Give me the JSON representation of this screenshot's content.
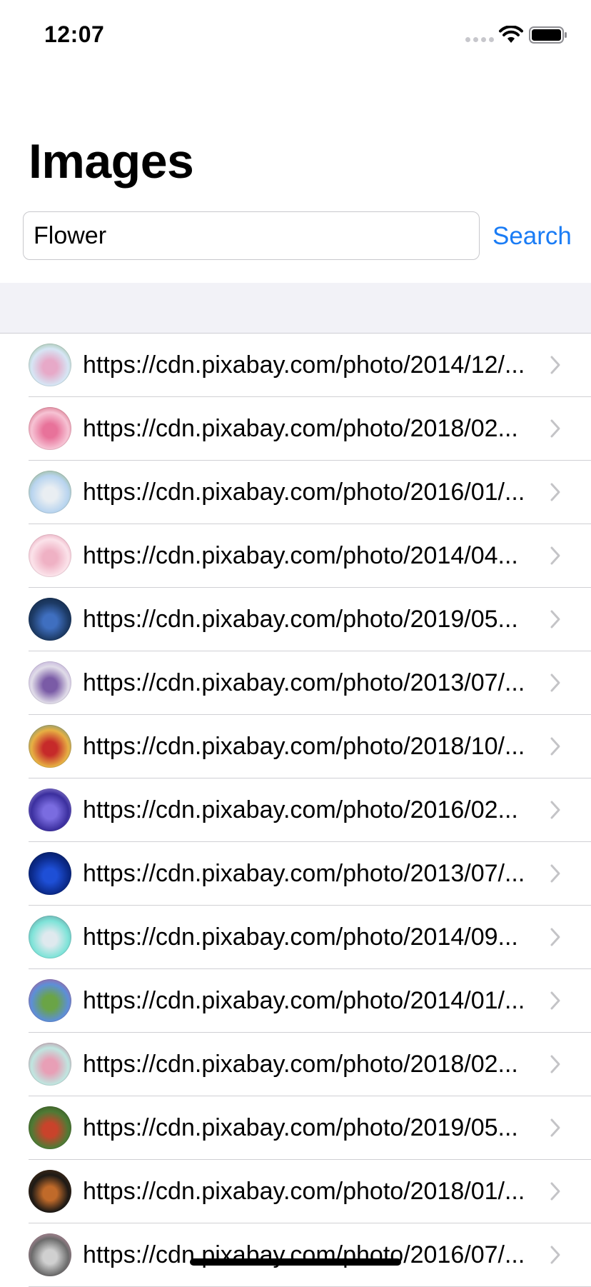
{
  "status_bar": {
    "time": "12:07"
  },
  "header": {
    "title": "Images"
  },
  "search": {
    "value": "Flower",
    "button_label": "Search"
  },
  "results": [
    {
      "url": "https://cdn.pixabay.com/photo/2014/12/...",
      "thumb_colors": [
        "#d6e6f5",
        "#e7a9c8",
        "#7aa86a"
      ]
    },
    {
      "url": "https://cdn.pixabay.com/photo/2018/02...",
      "thumb_colors": [
        "#f6c3d4",
        "#e8729a",
        "#c0364f"
      ]
    },
    {
      "url": "https://cdn.pixabay.com/photo/2016/01/...",
      "thumb_colors": [
        "#b8d4ef",
        "#e9eef2",
        "#8ba84e"
      ]
    },
    {
      "url": "https://cdn.pixabay.com/photo/2014/04...",
      "thumb_colors": [
        "#fbe3ea",
        "#efb1c4",
        "#d97a98"
      ]
    },
    {
      "url": "https://cdn.pixabay.com/photo/2019/05...",
      "thumb_colors": [
        "#1d3b66",
        "#3f6fc0",
        "#0f1f35"
      ]
    },
    {
      "url": "https://cdn.pixabay.com/photo/2013/07/...",
      "thumb_colors": [
        "#e0dce8",
        "#7a5ba6",
        "#a98bcf"
      ]
    },
    {
      "url": "https://cdn.pixabay.com/photo/2018/10/...",
      "thumb_colors": [
        "#e7b043",
        "#c62a2a",
        "#2f87a6"
      ]
    },
    {
      "url": "https://cdn.pixabay.com/photo/2016/02...",
      "thumb_colors": [
        "#3b2f9e",
        "#7a6ce0",
        "#c7b8f2"
      ]
    },
    {
      "url": "https://cdn.pixabay.com/photo/2013/07/...",
      "thumb_colors": [
        "#0b2a8a",
        "#1e4fd6",
        "#04123f"
      ]
    },
    {
      "url": "https://cdn.pixabay.com/photo/2014/09...",
      "thumb_colors": [
        "#7ee3d8",
        "#dfe9ee",
        "#5a7a86"
      ]
    },
    {
      "url": "https://cdn.pixabay.com/photo/2014/01/...",
      "thumb_colors": [
        "#5d8fd8",
        "#6aa446",
        "#d8497e"
      ]
    },
    {
      "url": "https://cdn.pixabay.com/photo/2018/02...",
      "thumb_colors": [
        "#bfe6e0",
        "#e89fb6",
        "#c45a7c"
      ]
    },
    {
      "url": "https://cdn.pixabay.com/photo/2019/05...",
      "thumb_colors": [
        "#4f7a35",
        "#c9432b",
        "#2b4a1c"
      ]
    },
    {
      "url": "https://cdn.pixabay.com/photo/2018/01/...",
      "thumb_colors": [
        "#1e1a16",
        "#c06a2a",
        "#5a3516"
      ]
    },
    {
      "url": "https://cdn.pixabay.com/photo/2016/07/...",
      "thumb_colors": [
        "#6b6b6b",
        "#d0d0d0",
        "#f2a4c3"
      ]
    }
  ],
  "colors": {
    "accent": "#1a7cf5",
    "section_bg": "#f2f2f7",
    "separator": "#d0d0d4",
    "chevron": "#c4c4c7"
  }
}
